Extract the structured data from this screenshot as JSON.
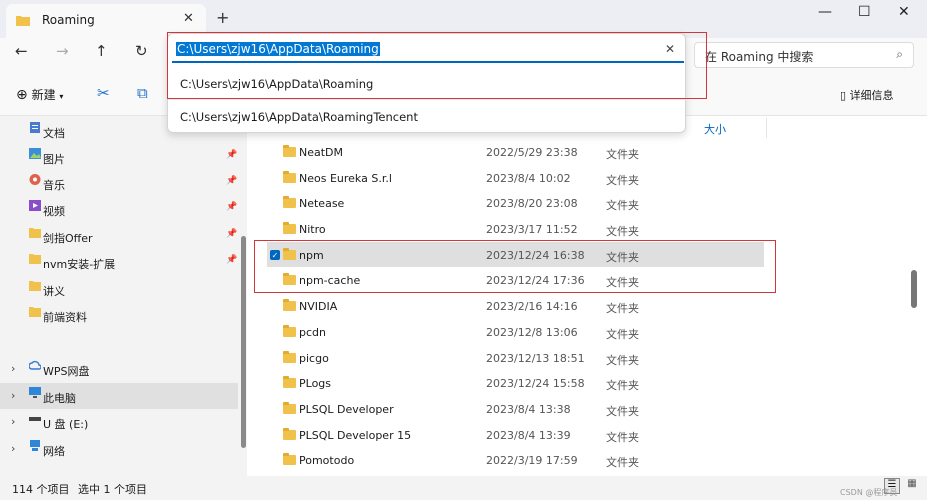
{
  "tab": {
    "title": "Roaming"
  },
  "address": {
    "value": "C:\\Users\\zjw16\\AppData\\Roaming",
    "suggestions": [
      "C:\\Users\\zjw16\\AppData\\Roaming",
      "C:\\Users\\zjw16\\AppData\\RoamingTencent"
    ]
  },
  "search": {
    "placeholder": "在 Roaming 中搜索"
  },
  "toolbar": {
    "new_label": "新建",
    "details_label": "详细信息"
  },
  "sidebar": {
    "quick": [
      {
        "label": "文档",
        "icon": "document-icon",
        "pinned": false
      },
      {
        "label": "图片",
        "icon": "picture-icon",
        "pinned": true
      },
      {
        "label": "音乐",
        "icon": "music-icon",
        "pinned": true
      },
      {
        "label": "视频",
        "icon": "video-icon",
        "pinned": true
      },
      {
        "label": "剑指Offer",
        "icon": "folder-icon",
        "pinned": true
      },
      {
        "label": "nvm安装-扩展",
        "icon": "folder-icon",
        "pinned": true
      },
      {
        "label": "讲义",
        "icon": "folder-icon",
        "pinned": false
      },
      {
        "label": "前端资料",
        "icon": "folder-icon",
        "pinned": false
      }
    ],
    "drives": [
      {
        "label": "WPS网盘",
        "icon": "cloud-icon",
        "selected": false
      },
      {
        "label": "此电脑",
        "icon": "computer-icon",
        "selected": true
      },
      {
        "label": "U 盘 (E:)",
        "icon": "usb-drive-icon",
        "selected": false
      },
      {
        "label": "网络",
        "icon": "network-icon",
        "selected": false
      }
    ]
  },
  "columns": {
    "size": "大小"
  },
  "files": [
    {
      "name": "NeatDM",
      "date": "2022/5/29 23:38",
      "type": "文件夹",
      "selected": false
    },
    {
      "name": "Neos Eureka S.r.l",
      "date": "2023/8/4 10:02",
      "type": "文件夹",
      "selected": false
    },
    {
      "name": "Netease",
      "date": "2023/8/20 23:08",
      "type": "文件夹",
      "selected": false
    },
    {
      "name": "Nitro",
      "date": "2023/3/17 11:52",
      "type": "文件夹",
      "selected": false
    },
    {
      "name": "npm",
      "date": "2023/12/24 16:38",
      "type": "文件夹",
      "selected": true
    },
    {
      "name": "npm-cache",
      "date": "2023/12/24 17:36",
      "type": "文件夹",
      "selected": false
    },
    {
      "name": "NVIDIA",
      "date": "2023/2/16 14:16",
      "type": "文件夹",
      "selected": false
    },
    {
      "name": "pcdn",
      "date": "2023/12/8 13:06",
      "type": "文件夹",
      "selected": false
    },
    {
      "name": "picgo",
      "date": "2023/12/13 18:51",
      "type": "文件夹",
      "selected": false
    },
    {
      "name": "PLogs",
      "date": "2023/12/24 15:58",
      "type": "文件夹",
      "selected": false
    },
    {
      "name": "PLSQL Developer",
      "date": "2023/8/4 13:38",
      "type": "文件夹",
      "selected": false
    },
    {
      "name": "PLSQL Developer 15",
      "date": "2023/8/4 13:39",
      "type": "文件夹",
      "selected": false
    },
    {
      "name": "Pomotodo",
      "date": "2022/3/19 17:59",
      "type": "文件夹",
      "selected": false
    }
  ],
  "status": {
    "count": "114 个项目",
    "selection": "选中 1 个项目"
  },
  "watermark": "CSDN @程序员"
}
